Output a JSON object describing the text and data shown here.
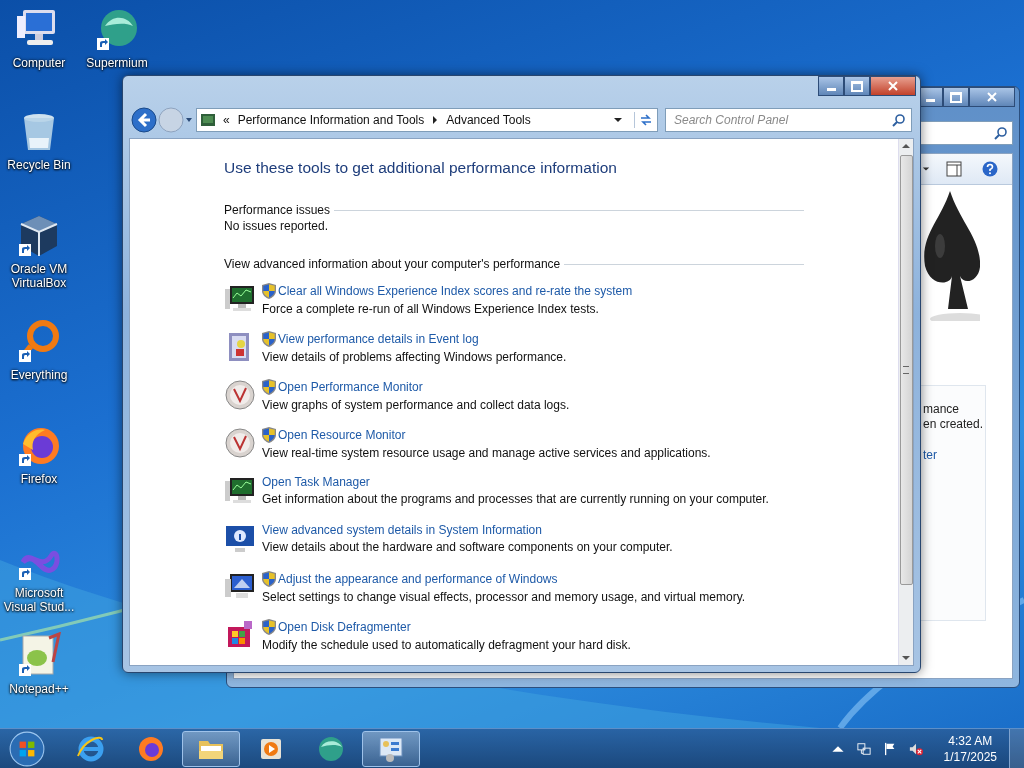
{
  "desktop_icons": [
    {
      "label": "Computer",
      "shortcut": false
    },
    {
      "label": "Supermium",
      "shortcut": true
    },
    {
      "label": "Recycle Bin",
      "shortcut": false
    },
    {
      "label": "Oracle VM VirtualBox",
      "shortcut": true
    },
    {
      "label": "Everything",
      "shortcut": true
    },
    {
      "label": "Firefox",
      "shortcut": true
    },
    {
      "label": "Microsoft Visual Stud...",
      "shortcut": true
    },
    {
      "label": "Notepad++",
      "shortcut": true
    }
  ],
  "back_window": {
    "texts": [
      "mance",
      "en created."
    ],
    "link": "ter"
  },
  "window": {
    "overflow_chevron": "«",
    "breadcrumbs": [
      "Performance Information and Tools",
      "Advanced Tools"
    ],
    "search": {
      "placeholder": "Search Control Panel"
    },
    "heading": "Use these tools to get additional performance information",
    "issues": {
      "title": "Performance issues",
      "text": "No issues reported."
    },
    "advanced_title": "View advanced information about your computer's performance",
    "tools": [
      {
        "link": "Clear all Windows Experience Index scores and re-rate the system",
        "description": "Force a complete re-run of all Windows Experience Index tests.",
        "shield": true
      },
      {
        "link": "View performance details in Event log",
        "description": "View details of problems affecting Windows performance.",
        "shield": true
      },
      {
        "link": "Open Performance Monitor",
        "description": "View graphs of system performance and collect data logs.",
        "shield": true
      },
      {
        "link": "Open Resource Monitor",
        "description": "View real-time system resource usage and manage active services and applications.",
        "shield": true
      },
      {
        "link": "Open Task Manager",
        "description": "Get information about the programs and processes that are currently running on your computer.",
        "shield": false
      },
      {
        "link": "View advanced system details in System Information",
        "description": "View details about the hardware and software components on your computer.",
        "shield": false
      },
      {
        "link": "Adjust the appearance and performance of Windows",
        "description": "Select settings to change visual effects, processor and memory usage, and virtual memory.",
        "shield": true
      },
      {
        "link": "Open Disk Defragmenter",
        "description": "Modify the schedule used to automatically defragment your hard disk.",
        "shield": true
      }
    ]
  },
  "taskbar": {
    "buttons": [
      {
        "selected": false
      },
      {
        "selected": false
      },
      {
        "selected": true
      },
      {
        "selected": false
      },
      {
        "selected": false
      },
      {
        "selected": true
      }
    ],
    "clock": {
      "time": "4:32 AM",
      "date": "1/17/2025"
    }
  }
}
